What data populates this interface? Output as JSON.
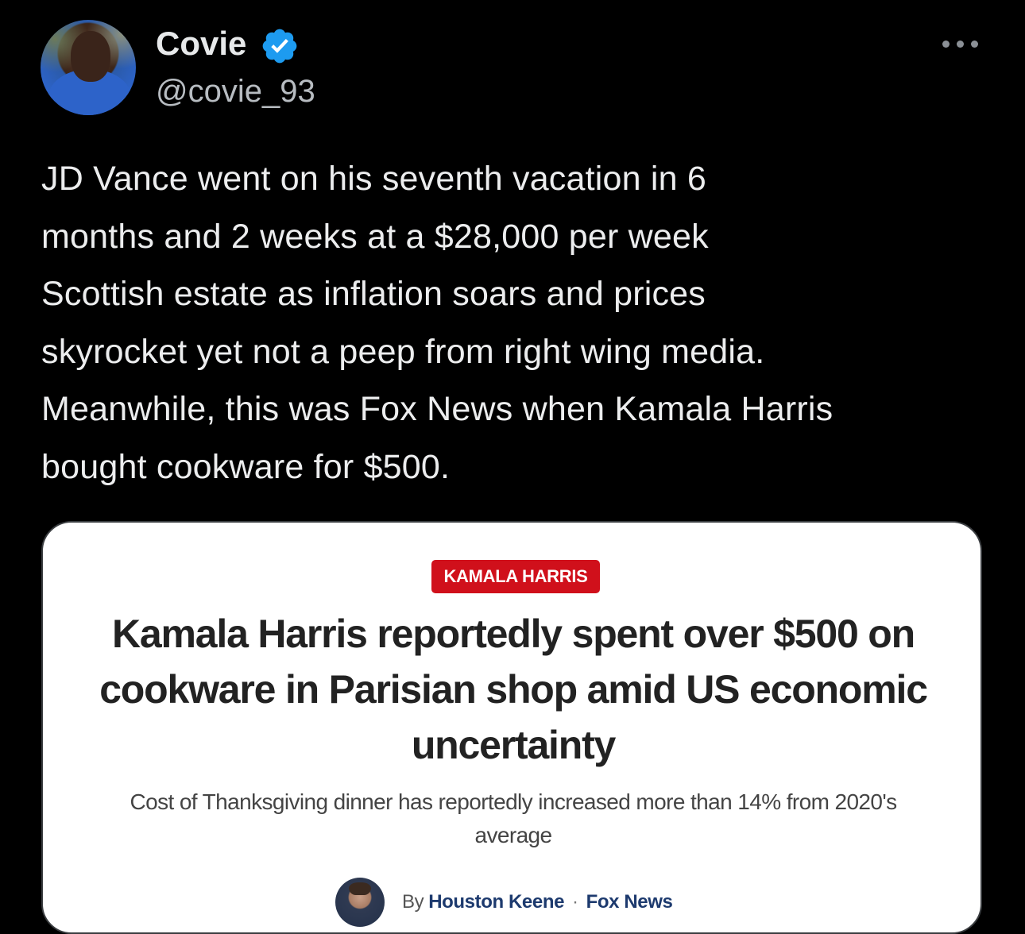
{
  "tweet": {
    "display_name": "Covie",
    "handle": "@covie_93",
    "verified_icon": "verified-badge-icon",
    "more_icon": "more-options-icon",
    "text": "JD Vance went on his seventh vacation in 6\nmonths and 2 weeks at a $28,000 per week\nScottish estate as inflation soars and prices\nskyrocket yet not a peep from right wing media.\nMeanwhile, this was Fox News when Kamala Harris\nbought cookware for $500."
  },
  "card": {
    "category": "KAMALA HARRIS",
    "headline": "Kamala Harris reportedly spent over $500 on cookware in Parisian shop amid US economic uncertainty",
    "subhead": "Cost of Thanksgiving dinner has reportedly increased more than 14% from 2020's average",
    "byline_prefix": "By",
    "author": "Houston Keene",
    "separator": "·",
    "outlet": "Fox News"
  },
  "colors": {
    "background": "#000000",
    "verified": "#1d9bf0",
    "badge": "#d0101b"
  }
}
